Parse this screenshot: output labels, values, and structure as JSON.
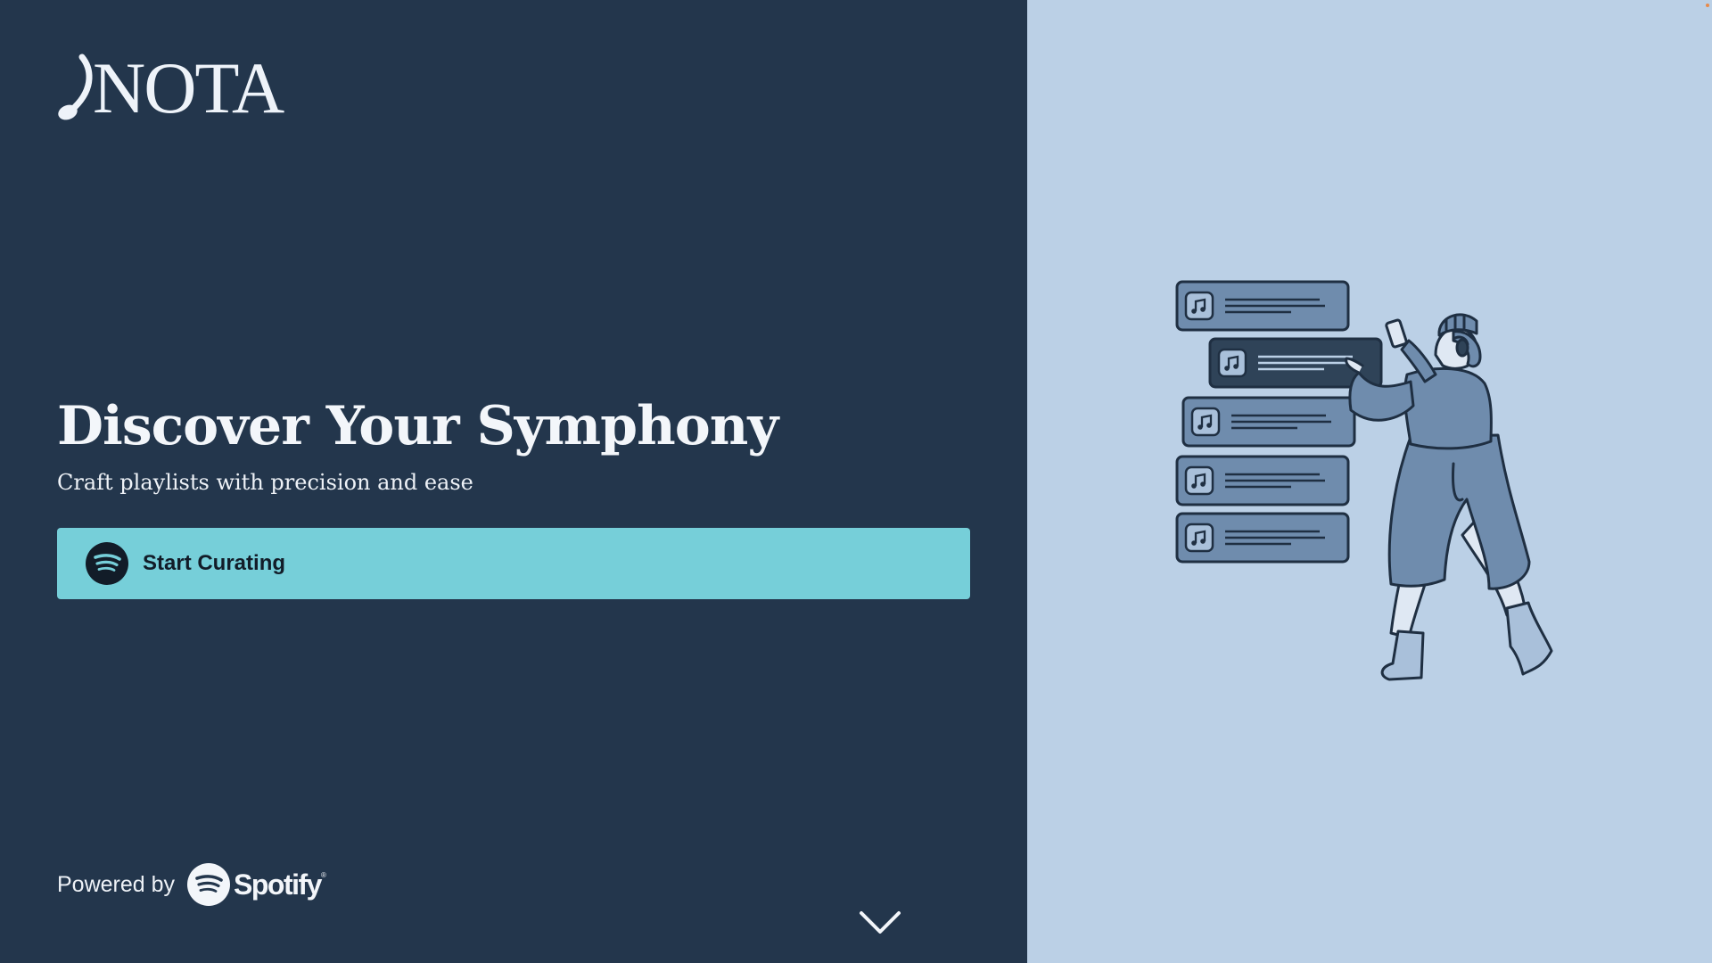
{
  "brand": {
    "logo_text": "NOTA",
    "logo_icon": "music-note-icon"
  },
  "hero": {
    "title": "Discover Your Symphony",
    "subtitle": "Craft playlists with precision and ease"
  },
  "cta": {
    "label": "Start Curating",
    "icon": "spotify-icon"
  },
  "footer": {
    "powered_by": "Powered by",
    "partner": "Spotify",
    "partner_mark": "®"
  },
  "scroll_indicator": {
    "icon": "chevron-down-icon"
  },
  "illustration": {
    "description_icon": "playlist-illustration",
    "track_card_icon": "music-note-icon"
  },
  "colors": {
    "left_panel": "#23364c",
    "right_panel": "#bbd0e6",
    "cta_background": "#76cfd9",
    "text_primary": "#f3f6fa",
    "illustration_accent": "#6f8cad",
    "illustration_dark": "#2f4358"
  }
}
